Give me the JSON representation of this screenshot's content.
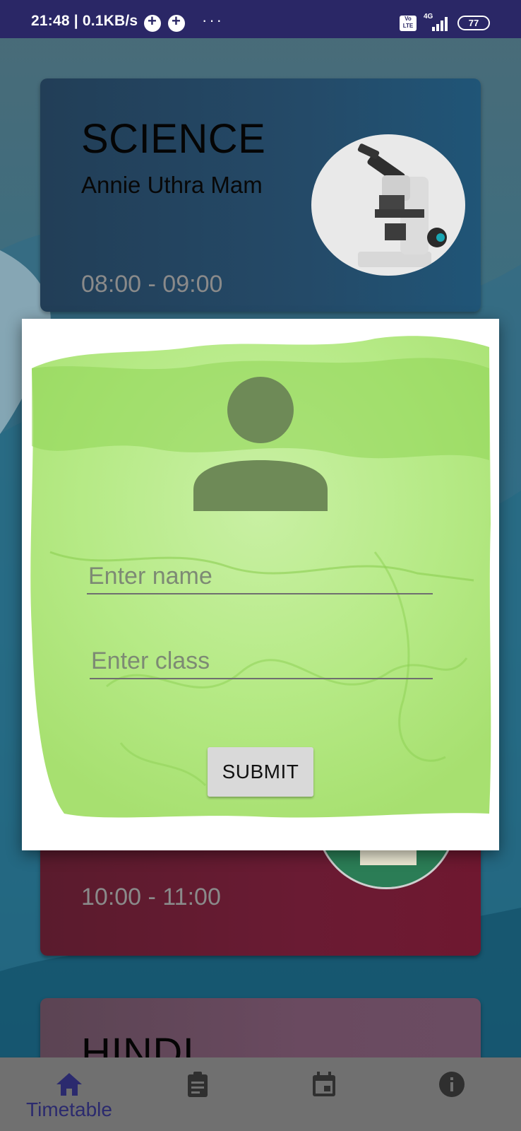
{
  "status_bar": {
    "time_speed": "21:48 | 0.1KB/s",
    "dots": "···",
    "volte": "Vo LTE",
    "network": "4G",
    "battery": "77"
  },
  "cards": [
    {
      "subject": "SCIENCE",
      "teacher": "Annie Uthra Mam",
      "time": "08:00  - 09:00",
      "thumb_icon": "microscope-icon"
    },
    {
      "subject": "",
      "teacher": "",
      "time": "10:00  - 11:00",
      "thumb_icon": "books-icon"
    },
    {
      "subject": "HINDI",
      "teacher": "",
      "time": ""
    }
  ],
  "dialog": {
    "avatar_icon": "person-icon",
    "name_placeholder": "Enter name",
    "class_placeholder": "Enter class",
    "submit_label": "SUBMIT"
  },
  "bottom_nav": {
    "items": [
      {
        "label": "Timetable",
        "icon": "home-icon",
        "active": true
      },
      {
        "label": "",
        "icon": "clipboard-icon",
        "active": false
      },
      {
        "label": "",
        "icon": "calendar-icon",
        "active": false
      },
      {
        "label": "",
        "icon": "info-icon",
        "active": false
      }
    ]
  },
  "colors": {
    "status_bar": "#2a2766",
    "science_card": "#244a68",
    "mid_card": "#6a1b33",
    "hindi_card": "#6a4a60",
    "nav_active": "#2b2a6e",
    "nav_bg": "#707070",
    "wash_green": "#9be26a"
  }
}
